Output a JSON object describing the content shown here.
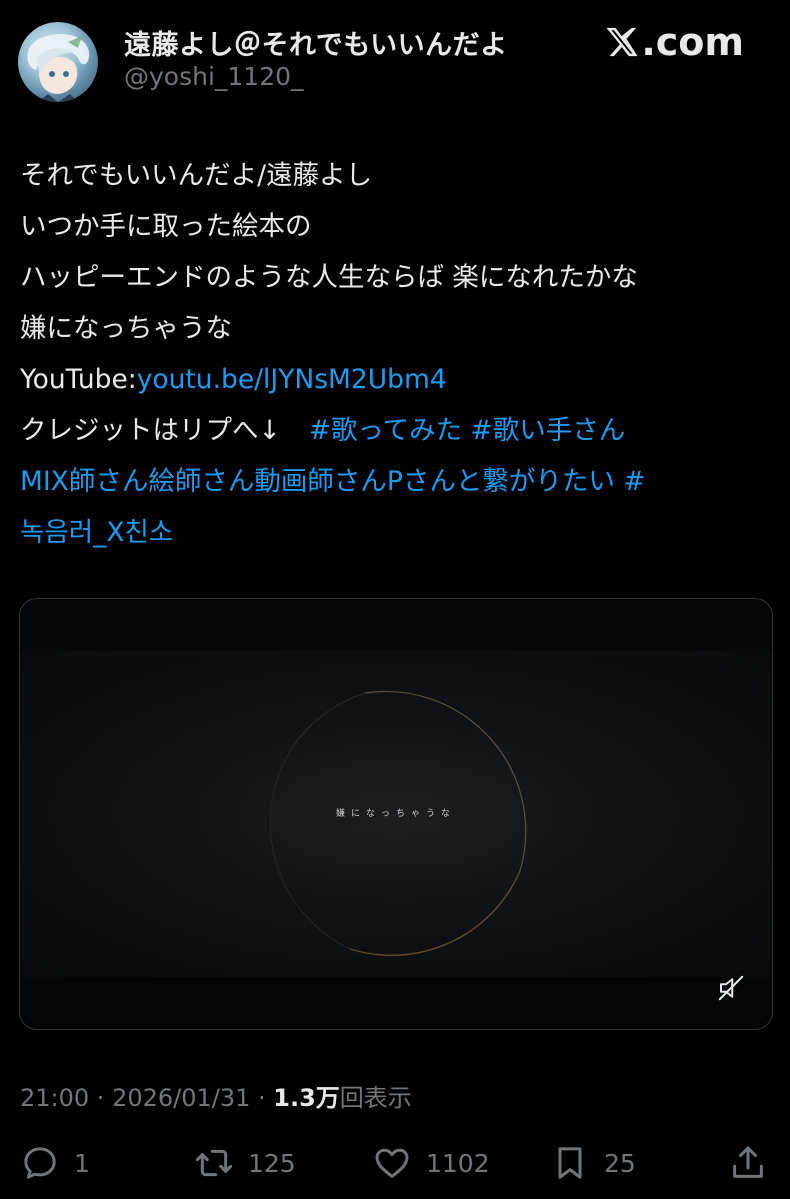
{
  "header": {
    "display_name": "遠藤よし＠それでもいいんだよ",
    "handle": "@yoshi_1120_",
    "brand": ".com"
  },
  "tweet": {
    "lines": [
      "それでもいいんだよ/遠藤よし",
      "いつか手に取った絵本の",
      "ハッピーエンドのような人生ならば 楽になれたかな",
      "嫌になっちゃうな"
    ],
    "youtube_prefix": "YouTube:",
    "youtube_link": "youtu.be/lJYNsM2Ubm4",
    "credit_text": "クレジットはリプへ↓",
    "hashtag_line1": "#歌ってみた #歌い手さん",
    "hashtag_line2": "MIX師さん絵師さん動画師さんPさんと繋がりたい #",
    "hashtag_line3": "녹음러_X친소"
  },
  "media": {
    "caption": "嫌になっちゃうな",
    "mute_icon": "volume-muted-icon"
  },
  "meta": {
    "time": "21:00",
    "separator1": " · ",
    "date": "2026/01/31",
    "separator2": " · ",
    "views": "1.3万",
    "views_label": "回表示"
  },
  "actions": {
    "reply_count": "1",
    "retweet_count": "125",
    "like_count": "1102",
    "bookmark_count": "25"
  },
  "colors": {
    "background": "#000000",
    "text": "#e7e9ea",
    "secondary": "#71767b",
    "link": "#1d9bf0"
  }
}
